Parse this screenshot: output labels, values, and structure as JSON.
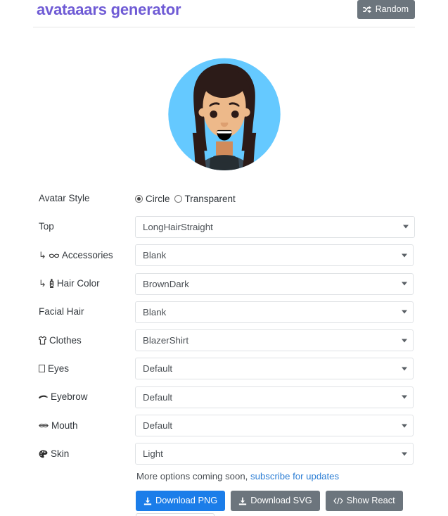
{
  "header": {
    "title": "avataaars generator",
    "random_button": {
      "label": "Random",
      "icon": "shuffle-icon",
      "bg": "#6c757d"
    },
    "title_color": "#6f5bd5"
  },
  "avatar": {
    "style": "Circle",
    "colors": {
      "background_circle": "#65C9FF",
      "hair": "#2C1B18",
      "skin": "#EDB98A",
      "shirt": "#262E33",
      "blazer": "#3A4C5A",
      "eyes": "#2C1B18",
      "mouth": "#000000"
    }
  },
  "form": {
    "rows": [
      {
        "label": "Avatar Style",
        "icon": null,
        "sub": false,
        "type": "radio",
        "options": [
          "Circle",
          "Transparent"
        ],
        "value": "Circle"
      },
      {
        "label": "Top",
        "icon": null,
        "sub": false,
        "type": "select",
        "value": "LongHairStraight",
        "width": "wide"
      },
      {
        "label": "Accessories",
        "icon": "glasses-icon",
        "sub": true,
        "type": "select",
        "value": "Blank",
        "width": "narrow"
      },
      {
        "label": "Hair Color",
        "icon": "barber-pole-icon",
        "sub": true,
        "type": "select",
        "value": "BrownDark",
        "width": "narrow"
      },
      {
        "label": "Facial Hair",
        "icon": null,
        "sub": false,
        "type": "select",
        "value": "Blank",
        "width": "narrow"
      },
      {
        "label": "Clothes",
        "icon": "tshirt-icon",
        "sub": false,
        "type": "select",
        "value": "BlazerShirt",
        "width": "narrow"
      },
      {
        "label": "Eyes",
        "icon": "missing-glyph-icon",
        "sub": false,
        "type": "select",
        "value": "Default",
        "width": "narrow"
      },
      {
        "label": "Eyebrow",
        "icon": "eyebrow-icon",
        "sub": false,
        "type": "select",
        "value": "Default",
        "width": "narrow"
      },
      {
        "label": "Mouth",
        "icon": "mouth-icon",
        "sub": false,
        "type": "select",
        "value": "Default",
        "width": "narrow"
      },
      {
        "label": "Skin",
        "icon": "palette-icon",
        "sub": false,
        "type": "select",
        "value": "Light",
        "width": "narrow"
      }
    ],
    "sub_arrow": "↳"
  },
  "footer": {
    "note_text": "More options coming soon,",
    "note_link": "subscribe for updates",
    "buttons": [
      {
        "label": "Download PNG",
        "icon": "download-icon",
        "style": "primary",
        "color": "#1b7de9"
      },
      {
        "label": "Download SVG",
        "icon": "download-icon",
        "style": "secondary",
        "color": "#6c757d"
      },
      {
        "label": "Show React",
        "icon": "code-icon",
        "style": "secondary",
        "color": "#6c757d"
      }
    ]
  }
}
